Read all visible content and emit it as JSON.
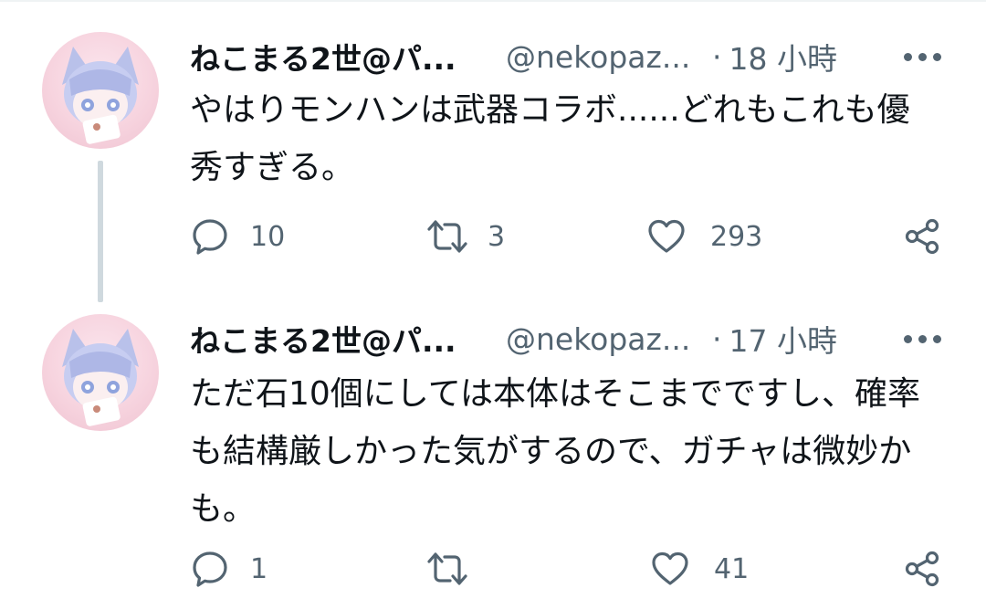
{
  "tweets": [
    {
      "display_name": "ねこまる2世@パ...",
      "handle": "@nekopaz...",
      "separator": "·",
      "time": "18 小時",
      "text": "やはりモンハンは武器コラボ......どれもこれも優\n秀すぎる。",
      "reply_count": "10",
      "retweet_count": "3",
      "like_count": "293"
    },
    {
      "display_name": "ねこまる2世@パ...",
      "handle": "@nekopaz...",
      "separator": "·",
      "time": "17 小時",
      "text": "ただ石10個にしては本体はそこまでですし、確率\nも結構厳しかった気がするので、ガチャは微妙か\nも。",
      "reply_count": "1",
      "retweet_count": "",
      "like_count": "41"
    }
  ],
  "icons": {
    "reply": "reply-icon",
    "retweet": "retweet-icon",
    "like": "heart-icon",
    "share": "share-icon",
    "more": "more-icon"
  },
  "colors": {
    "text": "#0f1419",
    "secondary": "#536471",
    "thread_line": "#cfd9de"
  }
}
